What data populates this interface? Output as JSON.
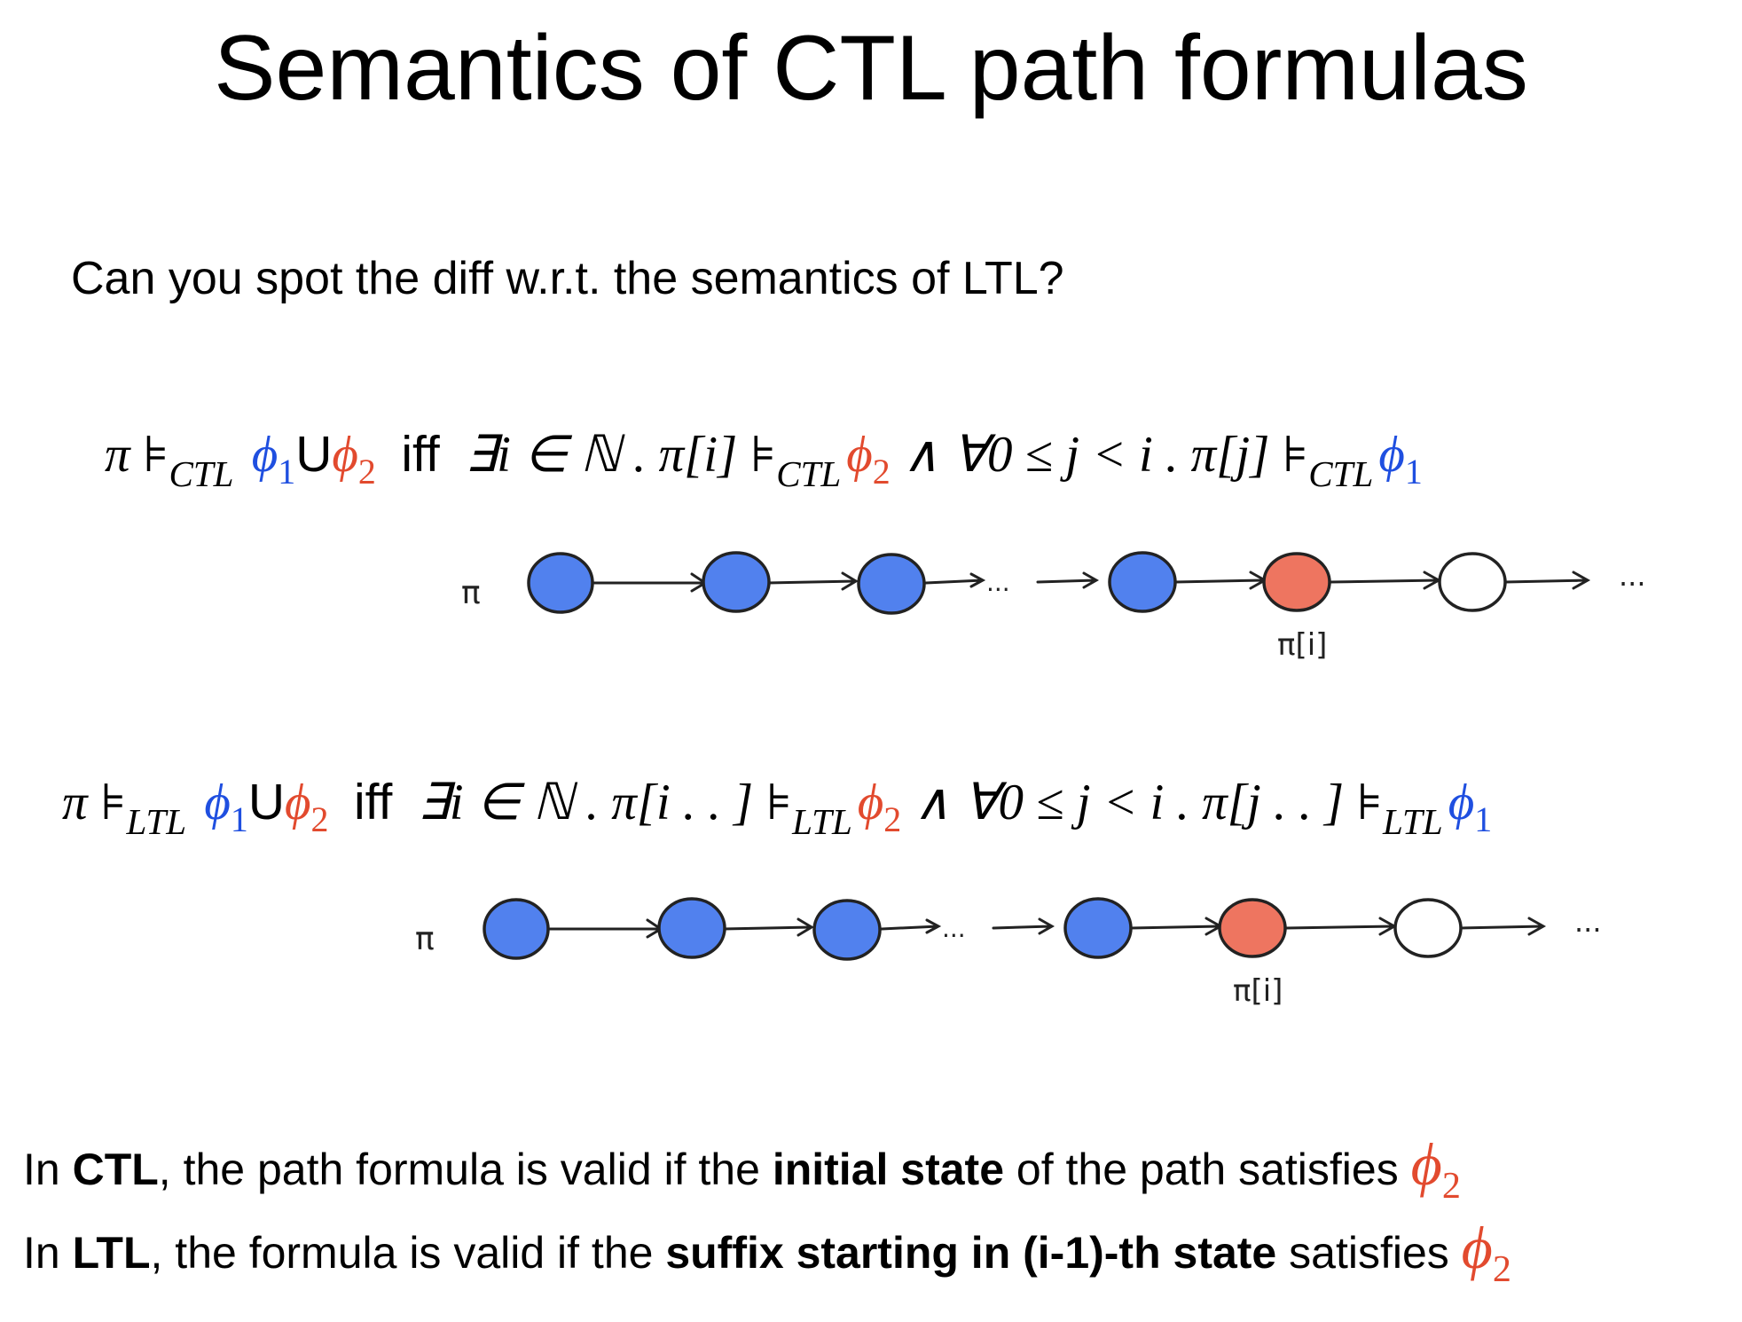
{
  "slide": {
    "title": "Semantics of CTL path formulas",
    "question": "Can you spot the diff w.r.t. the semantics of LTL?"
  },
  "formulas": {
    "ctl": {
      "pi": "π",
      "models": "⊧",
      "logic": "CTL",
      "phi": "ϕ",
      "one": "1",
      "two": "2",
      "until": "U",
      "iff": "iff",
      "exists_i": "∃i ∈ ℕ . π[i] ",
      "and_forall": " ∧ ∀0 ≤ j < i . π[j] "
    },
    "ltl": {
      "pi": "π",
      "models": "⊧",
      "logic": "LTL",
      "phi": "ϕ",
      "one": "1",
      "two": "2",
      "until": "U",
      "iff": "iff",
      "exists_i": "∃i ∈ ℕ . π[i . . ] ",
      "and_forall": " ∧ ∀0 ≤ j < i . π[j . . ] "
    }
  },
  "diagrams": {
    "path_label": "π",
    "ellipsis": "...",
    "marked_state_label": "π[i]",
    "state_colors": {
      "satisfies_phi1": "#5181ee",
      "satisfies_phi2": "#ee7560",
      "unknown": "#ffffff"
    },
    "states": [
      "phi1",
      "phi1",
      "phi1",
      "phi1",
      "phi2",
      "unknown"
    ]
  },
  "notes": {
    "ctl": {
      "prefix": "In ",
      "logic": "CTL",
      "middle": ", the path formula is valid if the ",
      "emphasis": "initial state",
      "suffix": " of the path satisfies ",
      "phi": "ϕ",
      "sub": "2"
    },
    "ltl": {
      "prefix": "In ",
      "logic": "LTL",
      "middle": ", the formula is valid if the ",
      "emphasis": "suffix starting in (i-1)-th state",
      "suffix": " satisfies ",
      "phi": "ϕ",
      "sub": "2"
    }
  }
}
